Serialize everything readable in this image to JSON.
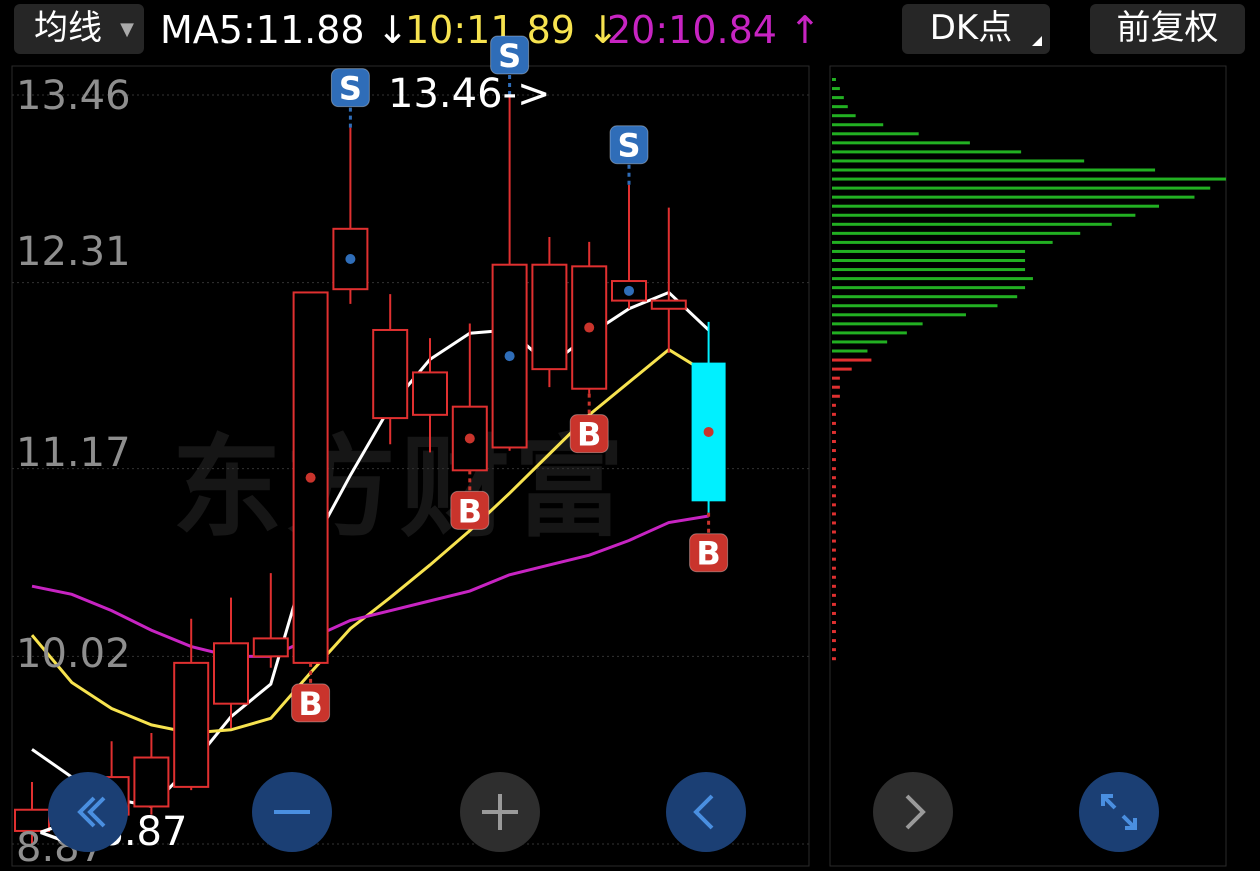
{
  "toolbar": {
    "ma_type_label": "均线",
    "ma5_text": "MA5:11.88 ↓",
    "ma10_text": "10:11.89 ↓",
    "ma20_text": "20:10.84 ↑",
    "dk_label": "DK点",
    "adjust_label": "前复权"
  },
  "watermark": "东方财富",
  "markers": {
    "high_label": "13.46->",
    "low_label": "<--8.87"
  },
  "colors": {
    "up": "#e03030",
    "down": "#00f0ff",
    "ma5": "#ffffff",
    "ma10": "#f7e34f",
    "ma20": "#c724c2",
    "buy_badge": "#c9342c",
    "sell_badge": "#2f6db8",
    "profile_green": "#22b022",
    "profile_red": "#e03030",
    "ctrl_blue": "#1b3f74",
    "ctrl_gray": "#2e2e2e"
  },
  "controls": [
    {
      "name": "rewind-icon",
      "style": "blue"
    },
    {
      "name": "zoom-out-icon",
      "style": "blue"
    },
    {
      "name": "zoom-in-icon",
      "style": "gray"
    },
    {
      "name": "prev-icon",
      "style": "blue"
    },
    {
      "name": "next-icon",
      "style": "gray"
    },
    {
      "name": "expand-icon",
      "style": "blue"
    }
  ],
  "chart_data": {
    "type": "candlestick",
    "y_ticks": [
      "13.46",
      "12.31",
      "11.17",
      "10.02",
      "8.87"
    ],
    "ylim": [
      8.87,
      13.46
    ],
    "candles": [
      {
        "o": 8.95,
        "c": 9.08,
        "h": 9.25,
        "l": 8.87
      },
      {
        "o": 9.08,
        "c": 9.15,
        "h": 9.28,
        "l": 9.0
      },
      {
        "o": 9.05,
        "c": 9.28,
        "h": 9.5,
        "l": 9.0
      },
      {
        "o": 9.1,
        "c": 9.4,
        "h": 9.55,
        "l": 9.05
      },
      {
        "o": 9.22,
        "c": 9.98,
        "h": 10.25,
        "l": 9.2
      },
      {
        "o": 9.73,
        "c": 10.1,
        "h": 10.38,
        "l": 9.58
      },
      {
        "o": 10.02,
        "c": 10.13,
        "h": 10.53,
        "l": 9.95
      },
      {
        "o": 9.98,
        "c": 12.25,
        "h": 12.25,
        "l": 9.98
      },
      {
        "o": 12.27,
        "c": 12.64,
        "h": 13.26,
        "l": 12.18
      },
      {
        "o": 11.48,
        "c": 12.02,
        "h": 12.24,
        "l": 11.32
      },
      {
        "o": 11.5,
        "c": 11.76,
        "h": 11.97,
        "l": 11.27
      },
      {
        "o": 11.16,
        "c": 11.55,
        "h": 12.06,
        "l": 11.16
      },
      {
        "o": 11.3,
        "c": 12.42,
        "h": 13.46,
        "l": 11.28
      },
      {
        "o": 11.78,
        "c": 12.42,
        "h": 12.59,
        "l": 11.67
      },
      {
        "o": 11.66,
        "c": 12.41,
        "h": 12.56,
        "l": 11.63
      },
      {
        "o": 12.2,
        "c": 12.32,
        "h": 12.91,
        "l": 12.15
      },
      {
        "o": 12.15,
        "c": 12.2,
        "h": 12.77,
        "l": 11.88
      },
      {
        "o": 11.82,
        "c": 10.97,
        "h": 12.07,
        "l": 10.9
      }
    ],
    "series": [
      {
        "name": "MA5",
        "values": [
          9.45,
          9.28,
          9.15,
          9.1,
          9.35,
          9.65,
          9.85,
          10.68,
          11.13,
          11.55,
          11.84,
          12.0,
          12.02,
          11.8,
          11.99,
          12.15,
          12.25,
          12.02
        ]
      },
      {
        "name": "MA10",
        "values": [
          10.15,
          9.86,
          9.7,
          9.6,
          9.55,
          9.57,
          9.64,
          9.92,
          10.19,
          10.38,
          10.58,
          10.79,
          11.02,
          11.26,
          11.5,
          11.7,
          11.9,
          11.75
        ]
      },
      {
        "name": "MA20",
        "values": [
          10.45,
          10.4,
          10.3,
          10.18,
          10.08,
          10.02,
          10.02,
          10.13,
          10.24,
          10.3,
          10.36,
          10.42,
          10.52,
          10.58,
          10.64,
          10.73,
          10.84,
          10.88
        ]
      }
    ],
    "signals": [
      {
        "type": "S",
        "index": 8
      },
      {
        "type": "S",
        "index": 12
      },
      {
        "type": "S",
        "index": 15
      },
      {
        "type": "B",
        "index": 7
      },
      {
        "type": "B",
        "index": 11
      },
      {
        "type": "B",
        "index": 14
      },
      {
        "type": "B",
        "index": 17
      }
    ],
    "volume_profile": {
      "green": [
        0.01,
        0.02,
        0.03,
        0.04,
        0.06,
        0.13,
        0.22,
        0.35,
        0.48,
        0.64,
        0.82,
        1.0,
        0.96,
        0.92,
        0.83,
        0.77,
        0.71,
        0.63,
        0.56,
        0.49,
        0.49,
        0.49,
        0.51,
        0.49,
        0.47,
        0.42,
        0.34,
        0.23,
        0.19,
        0.14,
        0.09
      ],
      "red": [
        0.1,
        0.05,
        0.02,
        0.02,
        0.02,
        0.01,
        0.01,
        0.01,
        0.01,
        0.01,
        0.01,
        0.01,
        0.01,
        0.01,
        0.01,
        0.01,
        0.01,
        0.01,
        0.01,
        0.01,
        0.01,
        0.01,
        0.01,
        0.01,
        0.01,
        0.01,
        0.01,
        0.01,
        0.01,
        0.01,
        0.01,
        0.01,
        0.01,
        0.01
      ]
    }
  }
}
